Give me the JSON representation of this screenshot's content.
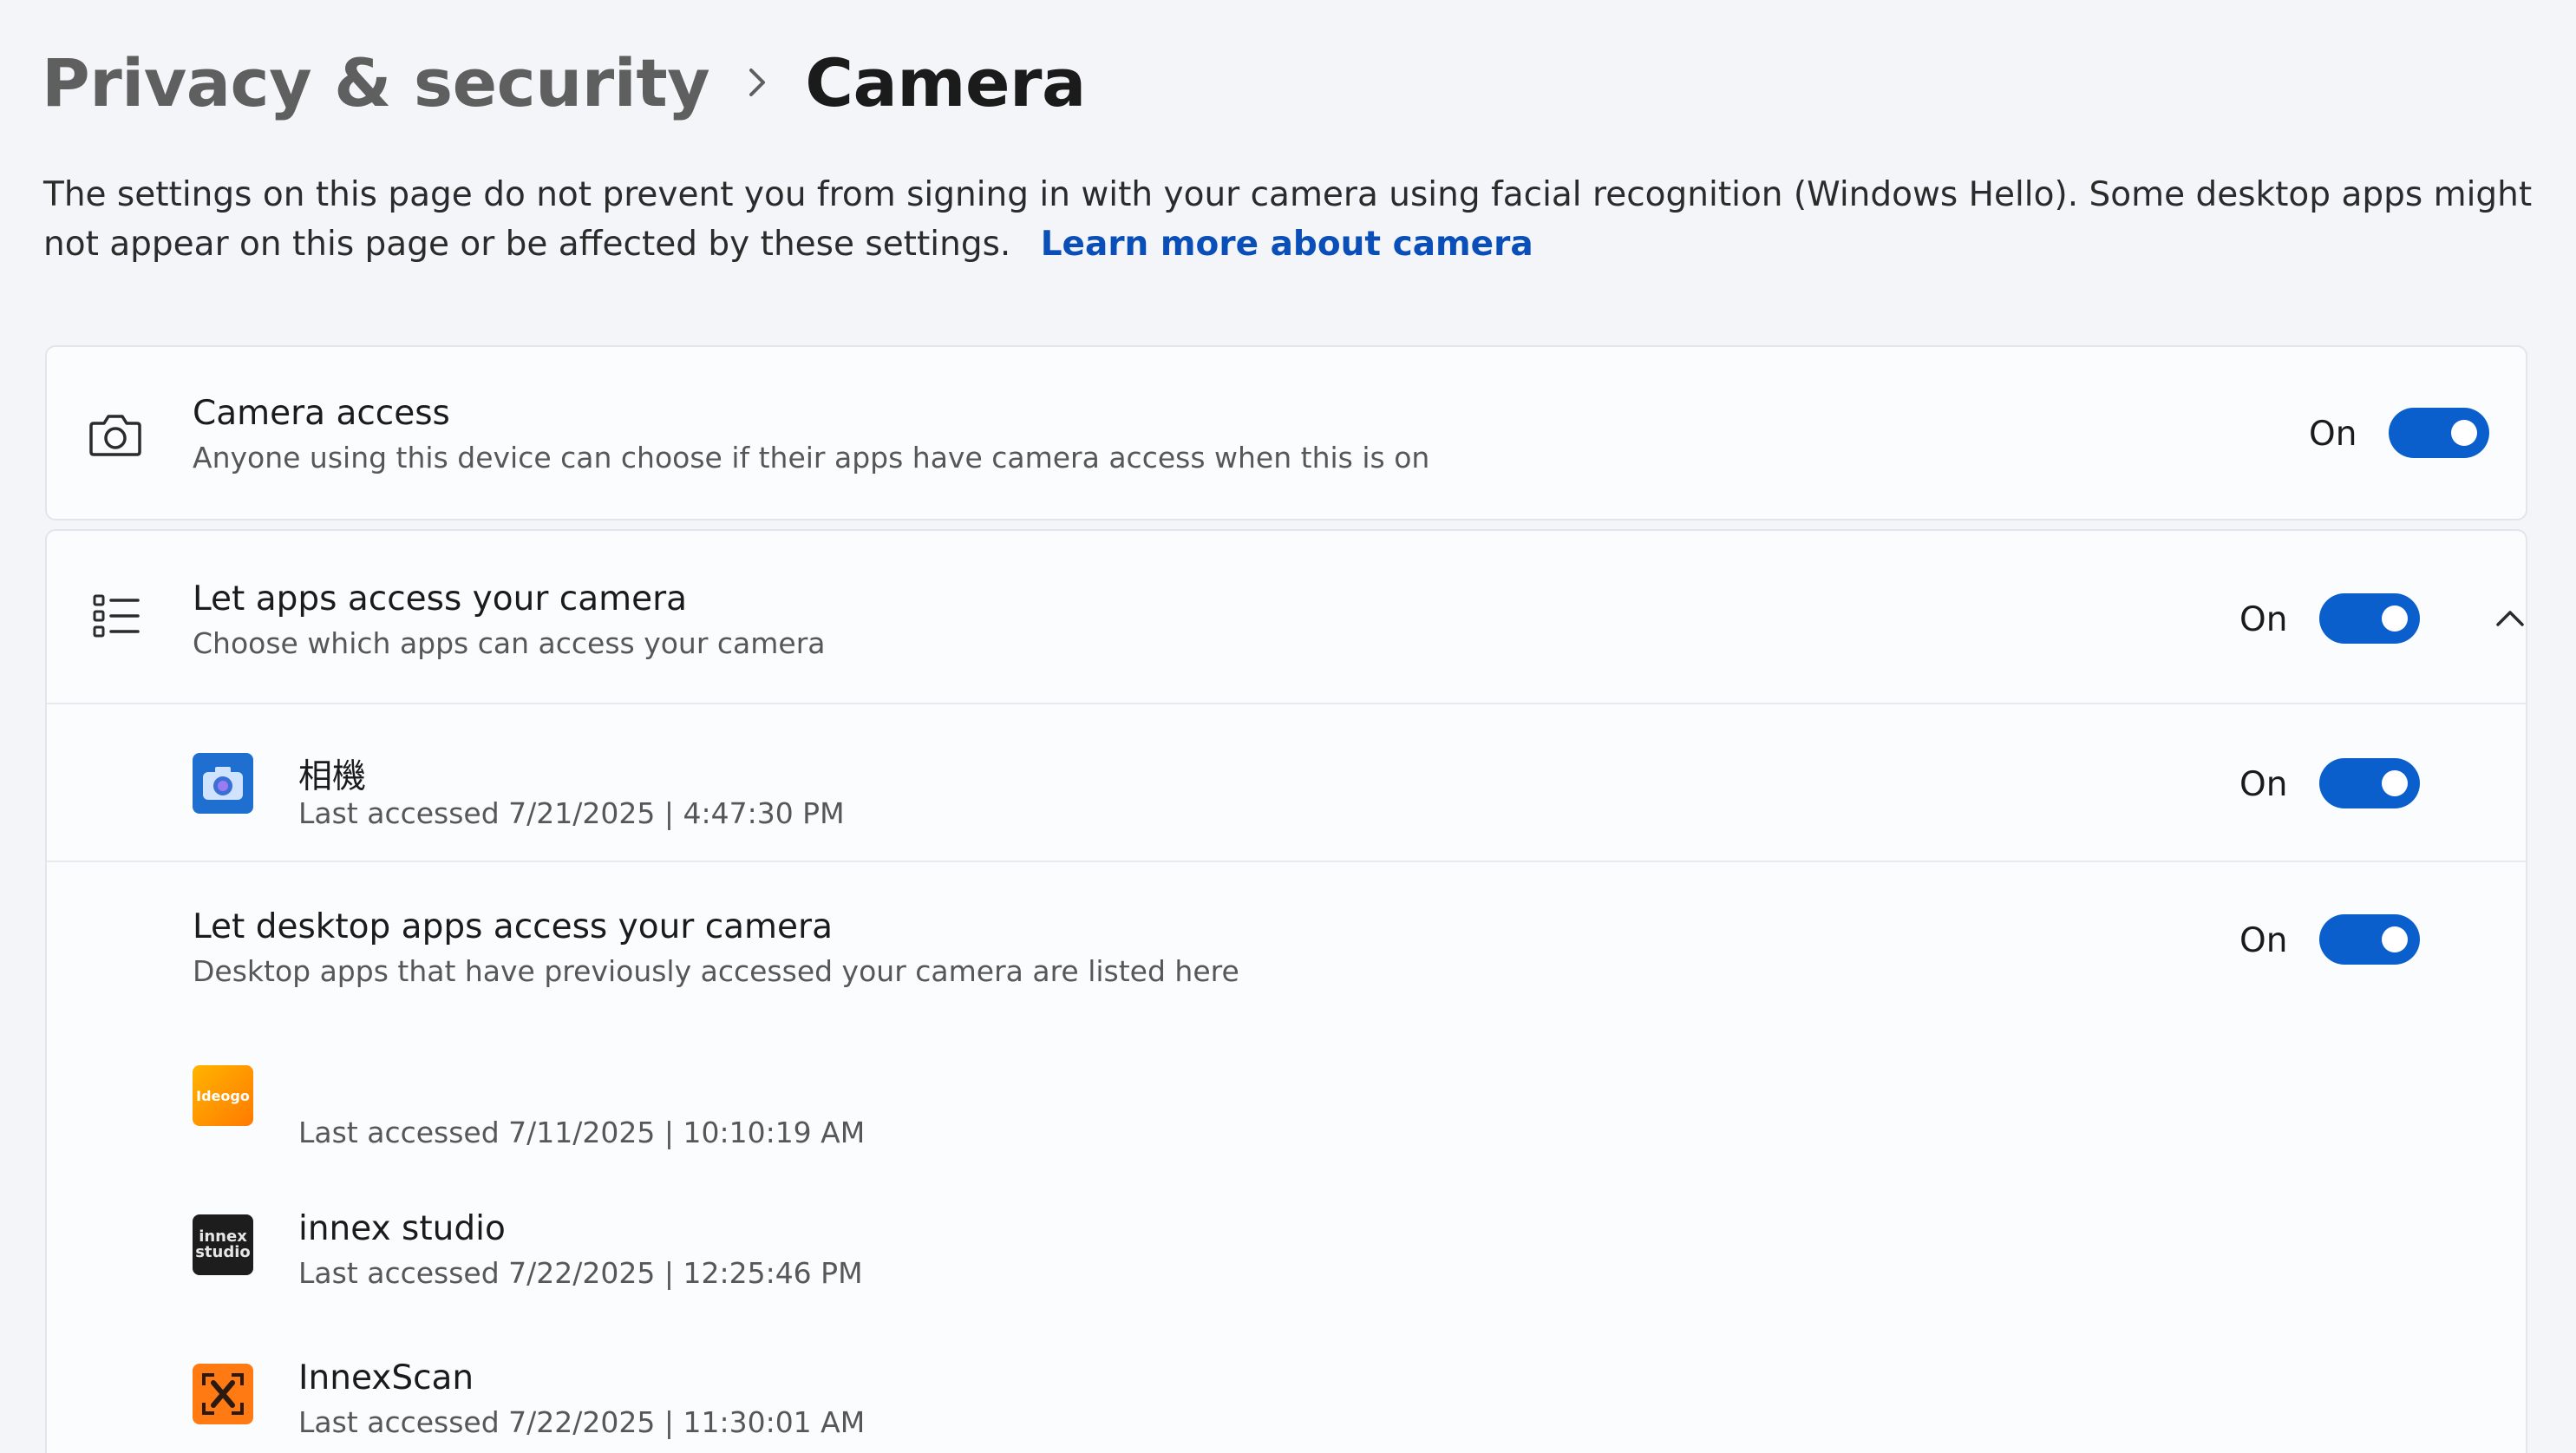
{
  "breadcrumb": {
    "parent": "Privacy & security",
    "current": "Camera"
  },
  "intro": {
    "text": "The settings on this page do not prevent you from signing in with your camera using facial recognition (Windows Hello). Some desktop apps might not appear on this page or be affected by these settings.",
    "link": "Learn more about camera"
  },
  "camera_access": {
    "title": "Camera access",
    "subtitle": "Anyone using this device can choose if their apps have camera access when this is on",
    "state": "On"
  },
  "apps_access": {
    "title": "Let apps access your camera",
    "subtitle": "Choose which apps can access your camera",
    "state": "On"
  },
  "camera_app": {
    "name": "相機",
    "last_accessed": "Last accessed 7/21/2025  |  4:47:30 PM",
    "state": "On"
  },
  "desktop_apps": {
    "title": "Let desktop apps access your camera",
    "subtitle": "Desktop apps that have previously accessed your camera are listed here",
    "state": "On",
    "items": [
      {
        "name": "",
        "icon_text": "Ideogo",
        "last_accessed": "Last accessed 7/11/2025  |  10:10:19 AM"
      },
      {
        "name": "innex studio",
        "icon_text": "innex studio",
        "last_accessed": "Last accessed 7/22/2025  |  12:25:46 PM"
      },
      {
        "name": "InnexScan",
        "icon_text": "",
        "last_accessed": "Last accessed 7/22/2025  |  11:30:01 AM"
      }
    ]
  },
  "colors": {
    "accent": "#0a5fcc",
    "link": "#0a4eb8",
    "background": "#f3f5f9",
    "card": "#fbfcfe"
  }
}
